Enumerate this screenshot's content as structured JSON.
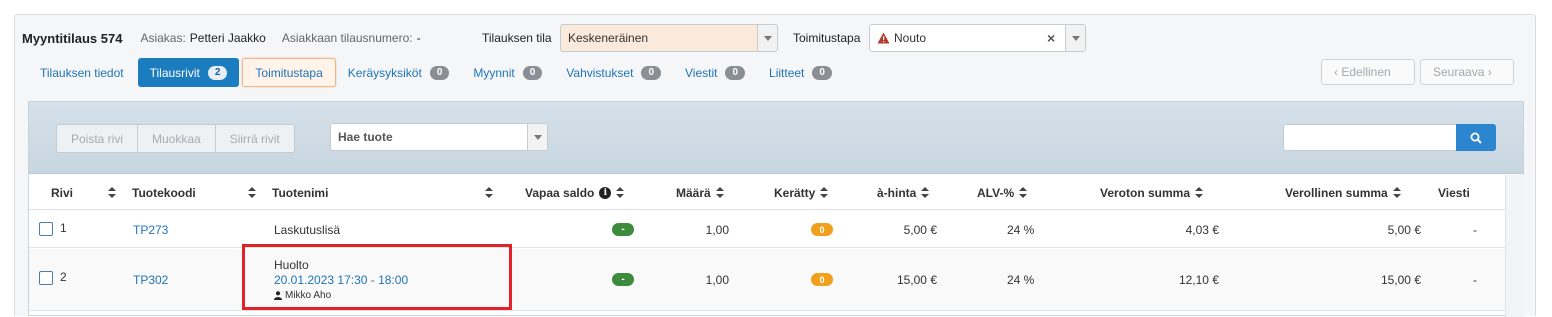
{
  "header": {
    "title": "Myyntitilaus 574",
    "customer_label": "Asiakas:",
    "customer_value": "Petteri Jaakko",
    "customer_order_label": "Asiakkaan tilausnumero:",
    "customer_order_value": "-",
    "status_label": "Tilauksen tila",
    "status_value": "Keskeneräinen",
    "delivery_label": "Toimitustapa",
    "delivery_value": "Nouto",
    "clear_symbol": "×"
  },
  "tabs": [
    {
      "label": "Tilauksen tiedot"
    },
    {
      "label": "Tilausrivit",
      "count": "2"
    },
    {
      "label": "Toimitustapa"
    },
    {
      "label": "Keräysyksiköt",
      "count": "0"
    },
    {
      "label": "Myynnit",
      "count": "0"
    },
    {
      "label": "Vahvistukset",
      "count": "0"
    },
    {
      "label": "Viestit",
      "count": "0"
    },
    {
      "label": "Liitteet",
      "count": "0"
    }
  ],
  "nav": {
    "prev_label": "‹ Edellinen",
    "next_label": "Seuraava ›"
  },
  "toolbar": {
    "delete_row": "Poista rivi",
    "edit": "Muokkaa",
    "move_rows": "Siirrä rivit",
    "product_search_placeholder": "Hae tuote"
  },
  "table": {
    "columns": {
      "row": "Rivi",
      "code": "Tuotekoodi",
      "name": "Tuotenimi",
      "free_balance": "Vapaa saldo",
      "quantity": "Määrä",
      "collected": "Kerätty",
      "unit_price": "à-hinta",
      "vat": "ALV-%",
      "net_total": "Veroton summa",
      "gross_total": "Verollinen summa",
      "message": "Viesti"
    },
    "rows": [
      {
        "row": "1",
        "code": "TP273",
        "name": "Laskutuslisä",
        "free_balance": "-",
        "quantity": "1,00",
        "collected": "0",
        "unit_price": "5,00 €",
        "vat": "24 %",
        "net_total": "4,03 €",
        "gross_total": "5,00 €",
        "message": "-"
      },
      {
        "row": "2",
        "code": "TP302",
        "name": "Huolto",
        "booking": "20.01.2023 17:30 - 18:00",
        "person": "Mikko Aho",
        "free_balance": "-",
        "quantity": "1,00",
        "collected": "0",
        "unit_price": "15,00 €",
        "vat": "24 %",
        "net_total": "12,10 €",
        "gross_total": "15,00 €",
        "message": "-"
      }
    ]
  },
  "colors": {
    "accent": "#1c7cc0",
    "status_select_bg": "#fbe9dc",
    "badge_green": "#3d8b3d",
    "badge_orange": "#f0a01c",
    "highlight_red": "#e0232b"
  }
}
